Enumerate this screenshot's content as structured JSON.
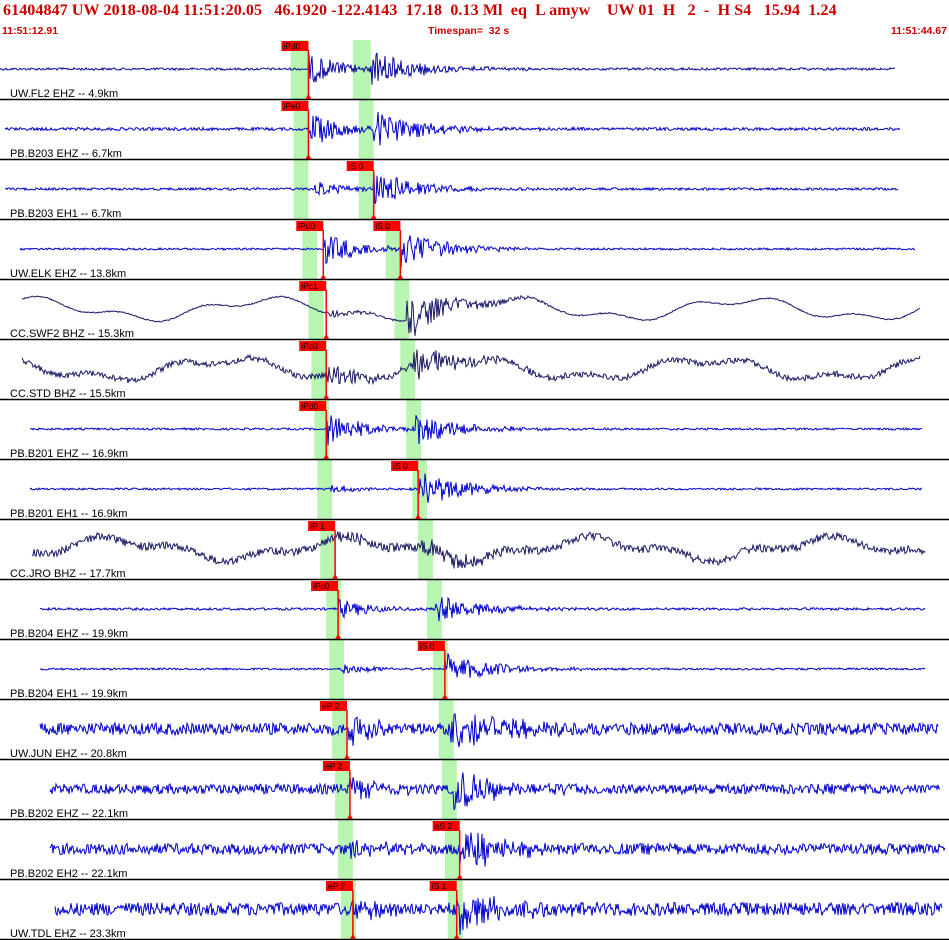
{
  "header": {
    "title": "61404847 UW 2018-08-04 11:51:20.05   46.1920 -122.4143  17.18  0.13 Ml  eq  L amyw    UW 01  H   2  -  H S4   15.94  1.24",
    "start_time": "11:51:12.91",
    "timespan": "Timespan=  32 s",
    "end_time": "11:51:44.67"
  },
  "colors": {
    "trace_blue": "#0000cc",
    "trace_navy": "#1a1a66",
    "pick_red": "#ff0000",
    "window_green": "#b8f5b0",
    "separator": "#000000",
    "header_red": "#cc0000"
  },
  "chart_data": {
    "type": "seismogram",
    "x_unit": "s",
    "xlim": [
      0,
      32
    ],
    "rows": [
      {
        "label": "UW.FL2 EHZ -- 4.9km",
        "color": "navy_blue",
        "p_label": "iPd0",
        "p_time": 10.4,
        "s_label": "",
        "s_time": 12.5,
        "p_win": [
          9.8,
          10.4
        ],
        "s_win": [
          11.9,
          12.5
        ]
      },
      {
        "label": "PB.B203 EHZ -- 6.7km",
        "color": "blue",
        "p_label": "iPe0",
        "p_time": 10.4,
        "s_label": "",
        "s_time": 12.6,
        "p_win": [
          9.9,
          10.4
        ],
        "s_win": [
          12.1,
          12.6
        ]
      },
      {
        "label": "PB.B203 EH1 -- 6.7km",
        "color": "blue",
        "p_label": "",
        "p_time": 10.6,
        "s_label": "iS 0",
        "s_time": 12.6,
        "p_win": [
          9.9,
          10.4
        ],
        "s_win": [
          12.1,
          12.6
        ]
      },
      {
        "label": "UW.ELK EHZ -- 13.8km",
        "color": "blue",
        "p_label": "iPd0",
        "p_time": 10.9,
        "s_label": "iS 0",
        "s_time": 13.5,
        "p_win": [
          10.2,
          10.7
        ],
        "s_win": [
          13.0,
          13.5
        ]
      },
      {
        "label": "CC.SWF2 BHZ -- 15.3km",
        "color": "navy",
        "p_label": "iPc1",
        "p_time": 11.0,
        "s_label": "",
        "s_time": 13.7,
        "p_win": [
          10.4,
          10.9
        ],
        "s_win": [
          13.3,
          13.8
        ]
      },
      {
        "label": "CC.STD BHZ -- 15.5km",
        "color": "navy",
        "p_label": "iPc0",
        "p_time": 11.0,
        "s_label": "",
        "s_time": 13.9,
        "p_win": [
          10.5,
          11.0
        ],
        "s_win": [
          13.5,
          14.0
        ]
      },
      {
        "label": "PB.B201 EHZ -- 16.9km",
        "color": "blue",
        "p_label": "iPd0",
        "p_time": 11.0,
        "s_label": "",
        "s_time": 14.0,
        "p_win": [
          10.6,
          11.1
        ],
        "s_win": [
          13.7,
          14.2
        ]
      },
      {
        "label": "PB.B201 EH1 -- 16.9km",
        "color": "blue",
        "p_label": "",
        "p_time": 11.1,
        "s_label": "iS 0",
        "s_time": 14.1,
        "p_win": [
          10.7,
          11.2
        ],
        "s_win": [
          13.9,
          14.4
        ]
      },
      {
        "label": "CC.JRO BHZ -- 17.7km",
        "color": "navy",
        "p_label": "iP 1",
        "p_time": 11.3,
        "s_label": "",
        "s_time": 14.2,
        "p_win": [
          10.8,
          11.3
        ],
        "s_win": [
          14.1,
          14.6
        ]
      },
      {
        "label": "PB.B204 EHZ -- 19.9km",
        "color": "blue",
        "p_label": "iPc0",
        "p_time": 11.4,
        "s_label": "",
        "s_time": 14.7,
        "p_win": [
          11.0,
          11.5
        ],
        "s_win": [
          14.4,
          14.9
        ]
      },
      {
        "label": "PB.B204 EH1 -- 19.9km",
        "color": "blue",
        "p_label": "",
        "p_time": 11.5,
        "s_label": "iS 0",
        "s_time": 15.0,
        "p_win": [
          11.1,
          11.6
        ],
        "s_win": [
          14.6,
          15.1
        ]
      },
      {
        "label": "UW.JUN EHZ -- 20.8km",
        "color": "blue",
        "p_label": "eP 2",
        "p_time": 11.7,
        "s_label": "",
        "s_time": 15.2,
        "p_win": [
          11.2,
          11.7
        ],
        "s_win": [
          14.8,
          15.3
        ]
      },
      {
        "label": "PB.B202 EHZ -- 22.1km",
        "color": "blue",
        "p_label": "eP 2",
        "p_time": 11.8,
        "s_label": "",
        "s_time": 15.3,
        "p_win": [
          11.3,
          11.8
        ],
        "s_win": [
          14.9,
          15.4
        ]
      },
      {
        "label": "PB.B202 EH2 -- 22.1km",
        "color": "blue",
        "p_label": "",
        "p_time": 11.8,
        "s_label": "eS 2",
        "s_time": 15.5,
        "p_win": [
          11.4,
          11.9
        ],
        "s_win": [
          15.0,
          15.5
        ]
      },
      {
        "label": "UW.TDL EHZ -- 23.3km",
        "color": "blue",
        "p_label": "eP 2",
        "p_time": 11.9,
        "s_label": "iS 1",
        "s_time": 15.4,
        "p_win": [
          11.5,
          12.0
        ],
        "s_win": [
          15.1,
          15.6
        ]
      }
    ]
  }
}
